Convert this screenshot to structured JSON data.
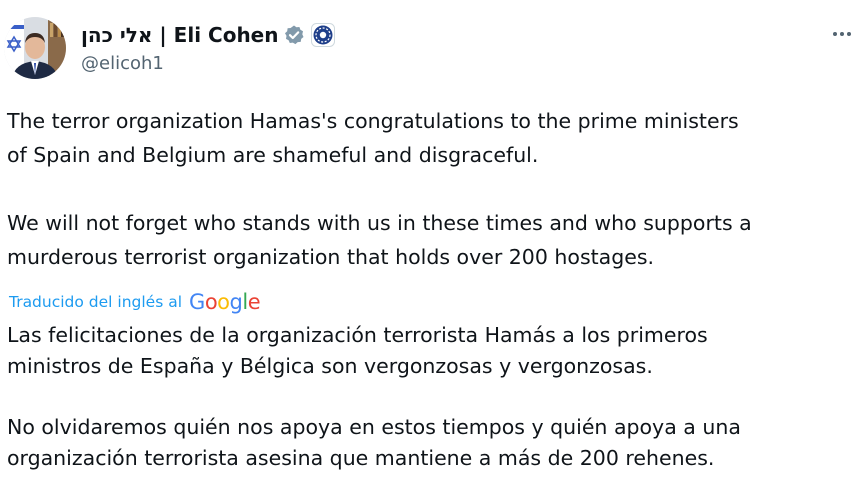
{
  "author": {
    "display_name": "אלי כהן | Eli Cohen",
    "handle": "@elicoh1",
    "avatar_icon": "profile-photo",
    "verified_icon": "verified-badge-icon",
    "affiliate_icon": "government-affiliate-icon"
  },
  "tweet": {
    "paragraph1_line1": "The terror organization Hamas's congratulations to the prime ministers",
    "paragraph1_line2": "of Spain and Belgium are shameful and disgraceful.",
    "paragraph2_line1": "We will not forget who stands with us in these times and who supports a",
    "paragraph2_line2": "murderous terrorist organization that holds over 200 hostages."
  },
  "translation": {
    "label": "Traducido del inglés al",
    "provider": "Google",
    "paragraph1_line1": "Las felicitaciones de la organización terrorista Hamás a los primeros",
    "paragraph1_line2": "ministros de España y Bélgica son vergonzosas y vergonzosas.",
    "paragraph2_line1": "No olvidaremos quién nos apoya en estos tiempos y quién apoya a una",
    "paragraph2_line2": "organización terrorista asesina que mantiene a más de 200 rehenes."
  },
  "colors": {
    "text": "#0f1419",
    "secondary": "#536471",
    "link": "#1d9bf0",
    "verified": "#829aab"
  }
}
